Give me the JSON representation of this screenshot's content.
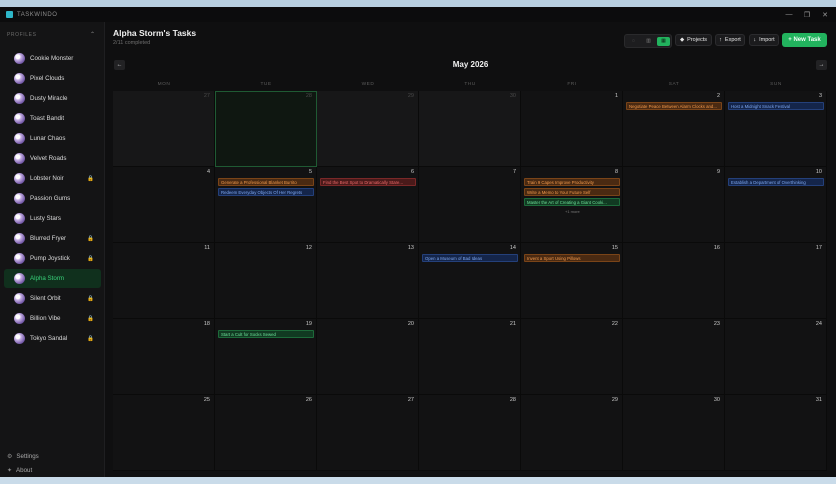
{
  "app": {
    "title": "TASKWINDO"
  },
  "sidebar": {
    "header": "PROFILES",
    "profiles": [
      {
        "name": "Cookie Monster",
        "locked": false,
        "active": false
      },
      {
        "name": "Pixel Clouds",
        "locked": false,
        "active": false
      },
      {
        "name": "Dusty Miracle",
        "locked": false,
        "active": false
      },
      {
        "name": "Toast Bandit",
        "locked": false,
        "active": false
      },
      {
        "name": "Lunar Chaos",
        "locked": false,
        "active": false
      },
      {
        "name": "Velvet Roads",
        "locked": false,
        "active": false
      },
      {
        "name": "Lobster Noir",
        "locked": true,
        "active": false
      },
      {
        "name": "Passion Gums",
        "locked": false,
        "active": false
      },
      {
        "name": "Lusty Stars",
        "locked": false,
        "active": false
      },
      {
        "name": "Blurred Fryer",
        "locked": true,
        "active": false
      },
      {
        "name": "Pump Joystick",
        "locked": true,
        "active": false
      },
      {
        "name": "Alpha Storm",
        "locked": false,
        "active": true
      },
      {
        "name": "Silent Orbit",
        "locked": true,
        "active": false
      },
      {
        "name": "Billion Vibe",
        "locked": true,
        "active": false
      },
      {
        "name": "Tokyo Sandal",
        "locked": true,
        "active": false
      }
    ],
    "settings_label": "Settings",
    "about_label": "About"
  },
  "header": {
    "title": "Alpha Storm's Tasks",
    "subtitle": "2/11 completed",
    "projects_label": "Projects",
    "export_label": "Export",
    "import_label": "Import",
    "new_task_label": "+ New Task"
  },
  "calendar": {
    "month_label": "May 2026",
    "weekdays": [
      "MON",
      "TUE",
      "WED",
      "THU",
      "FRI",
      "SAT",
      "SUN"
    ],
    "weeks": [
      [
        {
          "d": "27",
          "other": true
        },
        {
          "d": "28",
          "other": true,
          "today": true
        },
        {
          "d": "29",
          "other": true
        },
        {
          "d": "30",
          "other": true
        },
        {
          "d": "1"
        },
        {
          "d": "2"
        },
        {
          "d": "3"
        }
      ],
      [
        {
          "d": "4"
        },
        {
          "d": "5"
        },
        {
          "d": "6"
        },
        {
          "d": "7"
        },
        {
          "d": "8"
        },
        {
          "d": "9"
        },
        {
          "d": "10"
        }
      ],
      [
        {
          "d": "11"
        },
        {
          "d": "12"
        },
        {
          "d": "13"
        },
        {
          "d": "14"
        },
        {
          "d": "15"
        },
        {
          "d": "16"
        },
        {
          "d": "17"
        }
      ],
      [
        {
          "d": "18"
        },
        {
          "d": "19"
        },
        {
          "d": "20"
        },
        {
          "d": "21"
        },
        {
          "d": "22"
        },
        {
          "d": "23"
        },
        {
          "d": "24"
        }
      ],
      [
        {
          "d": "25"
        },
        {
          "d": "26"
        },
        {
          "d": "27"
        },
        {
          "d": "28"
        },
        {
          "d": "29"
        },
        {
          "d": "30"
        },
        {
          "d": "31"
        }
      ]
    ],
    "events": [
      {
        "week": 0,
        "day": 5,
        "slot": 0,
        "text": "Negotiate Peace Between Alarm Clocks and...",
        "color": "orange"
      },
      {
        "week": 0,
        "day": 6,
        "slot": 0,
        "text": "Host a Midnight Snack Festival",
        "color": "blue"
      },
      {
        "week": 1,
        "day": 1,
        "slot": 0,
        "text": "Generate a Professional Blanket Burrito",
        "color": "orange"
      },
      {
        "week": 1,
        "day": 1,
        "slot": 1,
        "text": "Redeem Everyday Objects Of Her Regrets",
        "color": "blue"
      },
      {
        "week": 1,
        "day": 2,
        "slot": 0,
        "text": "Find the Best Spot to Dramatically Stare...",
        "color": "red"
      },
      {
        "week": 1,
        "day": 4,
        "slot": 0,
        "text": "Train 9 Capes Improve Productivity",
        "color": "orange"
      },
      {
        "week": 1,
        "day": 4,
        "slot": 1,
        "text": "Write a Memo to Your Future Self",
        "color": "orange"
      },
      {
        "week": 1,
        "day": 4,
        "slot": 2,
        "text": "Master the Art of Creating a Giant Cooki...",
        "color": "green"
      },
      {
        "week": 1,
        "day": 6,
        "slot": 0,
        "text": "Establish a Department of Overthinking",
        "color": "blue"
      },
      {
        "week": 2,
        "day": 3,
        "slot": 0,
        "text": "Open a Museum of Bad Ideas",
        "color": "blue"
      },
      {
        "week": 2,
        "day": 4,
        "slot": 0,
        "text": "Invent a Sport Using Pillows",
        "color": "orange"
      },
      {
        "week": 3,
        "day": 1,
        "slot": 0,
        "text": "Start a Cult for Socks Sewed",
        "color": "green"
      }
    ],
    "more_label": "+1 more"
  },
  "colors": {
    "accent": "#22b35e",
    "background": "#0f0f10"
  }
}
